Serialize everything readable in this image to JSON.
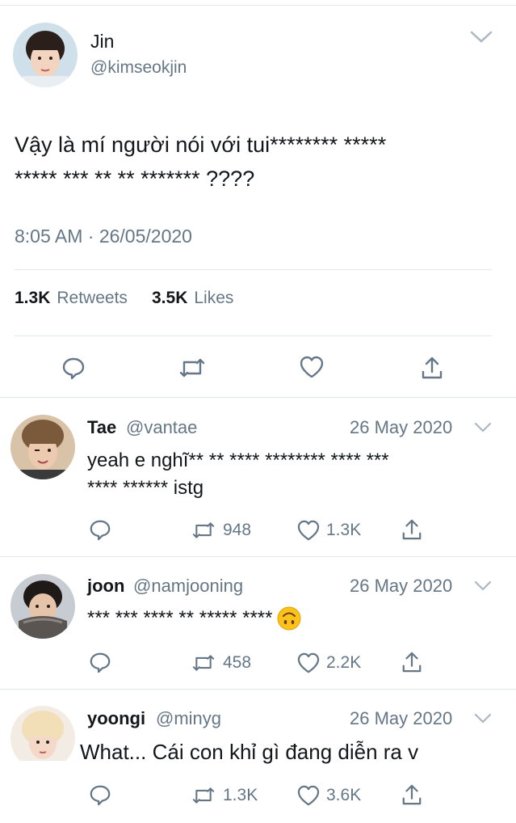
{
  "main_tweet": {
    "author_name": "Jin",
    "author_handle": "@kimseokjin",
    "text_line1": "Vậy là mí người nói với tui******** *****",
    "text_line2": "***** *** ** ** ******* ????",
    "timestamp": "8:05 AM · 26/05/2020",
    "retweets_count": "1.3K",
    "retweets_label": "Retweets",
    "likes_count": "3.5K",
    "likes_label": "Likes"
  },
  "replies": [
    {
      "author_name": "Tae",
      "author_handle": "@vantae",
      "date": "26 May 2020",
      "text_line1": "yeah e nghĩ** ** **** ******** **** ***",
      "text_line2": "**** ****** istg",
      "retweets": "948",
      "likes": "1.3K"
    },
    {
      "author_name": "joon",
      "author_handle": "@namjooning",
      "date": "26 May 2020",
      "text_line1": "*** *** **** ** ***** ****",
      "emoji": "upside-down-face",
      "retweets": "458",
      "likes": "2.2K"
    },
    {
      "author_name": "yoongi",
      "author_handle": "@minyg",
      "date": "26 May 2020",
      "text_line1": "What... Cái con khỉ gì đang diễn ra v",
      "retweets": "1.3K",
      "likes": "3.6K"
    }
  ],
  "icons": {
    "reply": "reply-icon",
    "retweet": "retweet-icon",
    "like": "heart-icon",
    "share": "share-icon",
    "menu": "chevron-down-icon"
  },
  "colors": {
    "text": "#14171a",
    "muted": "#657786",
    "divider": "#e1e8ed"
  }
}
